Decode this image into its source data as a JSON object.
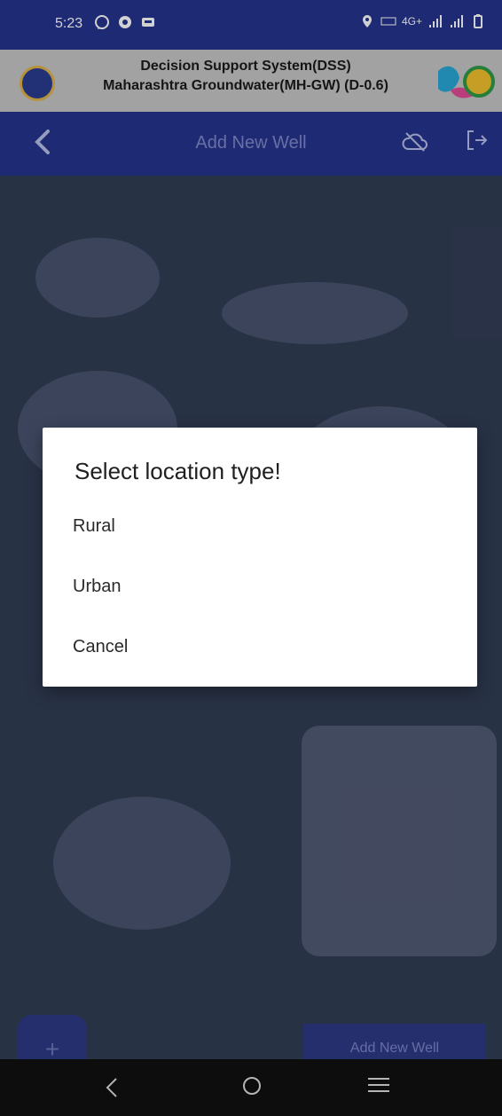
{
  "status": {
    "time": "5:23",
    "network": "4G+",
    "left_icons": [
      "whatsapp-icon",
      "record-icon",
      "message-icon"
    ],
    "right_icons": [
      "location-icon",
      "volte-icon",
      "signal-icon",
      "signal-icon",
      "battery-icon"
    ]
  },
  "header": {
    "line1": "Decision Support System(DSS)",
    "line2": "Maharashtra Groundwater(MH-GW) (D-0.6)"
  },
  "appbar": {
    "title": "Add New Well"
  },
  "dialog": {
    "title": "Select location type!",
    "options": [
      "Rural",
      "Urban",
      "Cancel"
    ]
  },
  "bottom": {
    "fab_label": "+",
    "add_button": "Add New Well"
  }
}
